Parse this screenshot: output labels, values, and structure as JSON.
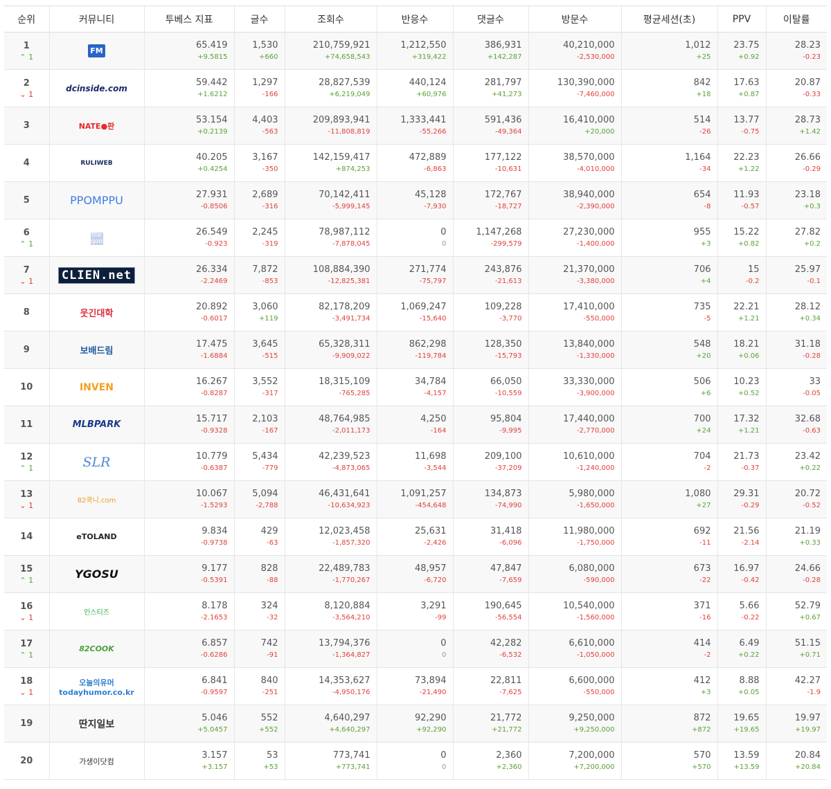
{
  "headers": [
    "순위",
    "커뮤니티",
    "투베스 지표",
    "글수",
    "조회수",
    "반응수",
    "댓글수",
    "방문수",
    "평균세션(초)",
    "PPV",
    "이탈률"
  ],
  "rows": [
    {
      "rank": "1",
      "change": "1",
      "change_dir": "up",
      "logo": {
        "text": "FM",
        "style": "fm"
      },
      "cells": [
        [
          "65.419",
          "+9.5815"
        ],
        [
          "1,530",
          "+660"
        ],
        [
          "210,759,921",
          "+74,658,543"
        ],
        [
          "1,212,550",
          "+319,422"
        ],
        [
          "386,931",
          "+142,287"
        ],
        [
          "40,210,000",
          "-2,530,000"
        ],
        [
          "1,012",
          "+25"
        ],
        [
          "23.75",
          "+0.92"
        ],
        [
          "28.23",
          "-0.23"
        ]
      ]
    },
    {
      "rank": "2",
      "change": "1",
      "change_dir": "down",
      "logo": {
        "text": "dcinside.com",
        "style": "dc"
      },
      "cells": [
        [
          "59.442",
          "+1.6212"
        ],
        [
          "1,297",
          "-166"
        ],
        [
          "28,827,539",
          "+6,219,049"
        ],
        [
          "440,124",
          "+60,976"
        ],
        [
          "281,797",
          "+41,273"
        ],
        [
          "130,390,000",
          "-7,460,000"
        ],
        [
          "842",
          "+18"
        ],
        [
          "17.63",
          "+0.87"
        ],
        [
          "20.87",
          "-0.33"
        ]
      ]
    },
    {
      "rank": "3",
      "change": "",
      "change_dir": "",
      "logo": {
        "text": "NATE●판",
        "style": "nate"
      },
      "cells": [
        [
          "53.154",
          "+0.2139"
        ],
        [
          "4,403",
          "-563"
        ],
        [
          "209,893,941",
          "-11,808,819"
        ],
        [
          "1,333,441",
          "-55,266"
        ],
        [
          "591,436",
          "-49,364"
        ],
        [
          "16,410,000",
          "+20,000"
        ],
        [
          "514",
          "-26"
        ],
        [
          "13.77",
          "-0.75"
        ],
        [
          "28.73",
          "+1.42"
        ]
      ]
    },
    {
      "rank": "4",
      "change": "",
      "change_dir": "",
      "logo": {
        "text": "RULIWEB",
        "style": "ruli"
      },
      "cells": [
        [
          "40.205",
          "+0.4254"
        ],
        [
          "3,167",
          "-350"
        ],
        [
          "142,159,417",
          "+874,253"
        ],
        [
          "472,889",
          "-6,863"
        ],
        [
          "177,122",
          "-10,631"
        ],
        [
          "38,570,000",
          "-4,010,000"
        ],
        [
          "1,164",
          "-34"
        ],
        [
          "22.23",
          "+1.22"
        ],
        [
          "26.66",
          "-0.29"
        ]
      ]
    },
    {
      "rank": "5",
      "change": "",
      "change_dir": "",
      "logo": {
        "text": "PPOMPPU",
        "style": "ppomppu"
      },
      "cells": [
        [
          "27.931",
          "-0.8506"
        ],
        [
          "2,689",
          "-316"
        ],
        [
          "70,142,411",
          "-5,999,145"
        ],
        [
          "45,128",
          "-7,930"
        ],
        [
          "172,767",
          "-18,727"
        ],
        [
          "38,940,000",
          "-2,390,000"
        ],
        [
          "654",
          "-8"
        ],
        [
          "11.93",
          "-0.57"
        ],
        [
          "23.18",
          "+0.3"
        ]
      ]
    },
    {
      "rank": "6",
      "change": "1",
      "change_dir": "up",
      "logo": {
        "text": "the qoo",
        "style": "qoo"
      },
      "cells": [
        [
          "26.549",
          "-0.923"
        ],
        [
          "2,245",
          "-319"
        ],
        [
          "78,987,112",
          "-7,878,045"
        ],
        [
          "0",
          "0"
        ],
        [
          "1,147,268",
          "-299,579"
        ],
        [
          "27,230,000",
          "-1,400,000"
        ],
        [
          "955",
          "+3"
        ],
        [
          "15.22",
          "+0.82"
        ],
        [
          "27.82",
          "+0.2"
        ]
      ]
    },
    {
      "rank": "7",
      "change": "1",
      "change_dir": "down",
      "logo": {
        "text": "CLIEN.net",
        "style": "clien"
      },
      "cells": [
        [
          "26.334",
          "-2.2469"
        ],
        [
          "7,872",
          "-853"
        ],
        [
          "108,884,390",
          "-12,825,381"
        ],
        [
          "271,774",
          "-75,797"
        ],
        [
          "243,876",
          "-21,613"
        ],
        [
          "21,370,000",
          "-3,380,000"
        ],
        [
          "706",
          "+4"
        ],
        [
          "15",
          "-0.2"
        ],
        [
          "25.97",
          "-0.1"
        ]
      ]
    },
    {
      "rank": "8",
      "change": "",
      "change_dir": "",
      "logo": {
        "text": "웃긴대학",
        "style": "humor"
      },
      "cells": [
        [
          "20.892",
          "-0.6017"
        ],
        [
          "3,060",
          "+119"
        ],
        [
          "82,178,209",
          "-3,491,734"
        ],
        [
          "1,069,247",
          "-15,640"
        ],
        [
          "109,228",
          "-3,770"
        ],
        [
          "17,410,000",
          "-550,000"
        ],
        [
          "735",
          "-5"
        ],
        [
          "22.21",
          "+1.21"
        ],
        [
          "28.12",
          "+0.34"
        ]
      ]
    },
    {
      "rank": "9",
      "change": "",
      "change_dir": "",
      "logo": {
        "text": "보배드림",
        "style": "bobae"
      },
      "cells": [
        [
          "17.475",
          "-1.6884"
        ],
        [
          "3,645",
          "-515"
        ],
        [
          "65,328,311",
          "-9,909,022"
        ],
        [
          "862,298",
          "-119,784"
        ],
        [
          "128,350",
          "-15,793"
        ],
        [
          "13,840,000",
          "-1,330,000"
        ],
        [
          "548",
          "+20"
        ],
        [
          "18.21",
          "+0.06"
        ],
        [
          "31.18",
          "-0.28"
        ]
      ]
    },
    {
      "rank": "10",
      "change": "",
      "change_dir": "",
      "logo": {
        "text": "INVEN",
        "style": "inven"
      },
      "cells": [
        [
          "16.267",
          "-0.8287"
        ],
        [
          "3,552",
          "-317"
        ],
        [
          "18,315,109",
          "-765,285"
        ],
        [
          "34,784",
          "-4,157"
        ],
        [
          "66,050",
          "-10,559"
        ],
        [
          "33,330,000",
          "-3,900,000"
        ],
        [
          "506",
          "+6"
        ],
        [
          "10.23",
          "+0.52"
        ],
        [
          "33",
          "-0.05"
        ]
      ]
    },
    {
      "rank": "11",
      "change": "",
      "change_dir": "",
      "logo": {
        "text": "MLBPARK",
        "style": "mlb"
      },
      "cells": [
        [
          "15.717",
          "-0.9328"
        ],
        [
          "2,103",
          "-167"
        ],
        [
          "48,764,985",
          "-2,011,173"
        ],
        [
          "4,250",
          "-164"
        ],
        [
          "95,804",
          "-9,995"
        ],
        [
          "17,440,000",
          "-2,770,000"
        ],
        [
          "700",
          "+24"
        ],
        [
          "17.32",
          "+1.21"
        ],
        [
          "32.68",
          "-0.63"
        ]
      ]
    },
    {
      "rank": "12",
      "change": "1",
      "change_dir": "up",
      "logo": {
        "text": "SLR",
        "style": "slr"
      },
      "cells": [
        [
          "10.779",
          "-0.6387"
        ],
        [
          "5,434",
          "-779"
        ],
        [
          "42,239,523",
          "-4,873,065"
        ],
        [
          "11,698",
          "-3,544"
        ],
        [
          "209,100",
          "-37,209"
        ],
        [
          "10,610,000",
          "-1,240,000"
        ],
        [
          "704",
          "-2"
        ],
        [
          "21.73",
          "-0.37"
        ],
        [
          "23.42",
          "+0.22"
        ]
      ]
    },
    {
      "rank": "13",
      "change": "1",
      "change_dir": "down",
      "logo": {
        "text": "82쿡니.com",
        "style": "ddanzi2"
      },
      "cells": [
        [
          "10.067",
          "-1.5293"
        ],
        [
          "5,094",
          "-2,788"
        ],
        [
          "46,431,641",
          "-10,634,923"
        ],
        [
          "1,091,257",
          "-454,648"
        ],
        [
          "134,873",
          "-74,990"
        ],
        [
          "5,980,000",
          "-1,650,000"
        ],
        [
          "1,080",
          "+27"
        ],
        [
          "29.31",
          "-0.29"
        ],
        [
          "20.72",
          "-0.52"
        ]
      ]
    },
    {
      "rank": "14",
      "change": "",
      "change_dir": "",
      "logo": {
        "text": "eTOLAND",
        "style": "etoland"
      },
      "cells": [
        [
          "9.834",
          "-0.9738"
        ],
        [
          "429",
          "-63"
        ],
        [
          "12,023,458",
          "-1,857,320"
        ],
        [
          "25,631",
          "-2,426"
        ],
        [
          "31,418",
          "-6,096"
        ],
        [
          "11,980,000",
          "-1,750,000"
        ],
        [
          "692",
          "-11"
        ],
        [
          "21.56",
          "-2.14"
        ],
        [
          "21.19",
          "+0.33"
        ]
      ]
    },
    {
      "rank": "15",
      "change": "1",
      "change_dir": "up",
      "logo": {
        "text": "YGOSU",
        "style": "ygosu"
      },
      "cells": [
        [
          "9.177",
          "-0.5391"
        ],
        [
          "828",
          "-88"
        ],
        [
          "22,489,783",
          "-1,770,267"
        ],
        [
          "48,957",
          "-6,720"
        ],
        [
          "47,847",
          "-7,659"
        ],
        [
          "6,080,000",
          "-590,000"
        ],
        [
          "673",
          "-22"
        ],
        [
          "16.97",
          "-0.42"
        ],
        [
          "24.66",
          "-0.28"
        ]
      ]
    },
    {
      "rank": "16",
      "change": "1",
      "change_dir": "down",
      "logo": {
        "text": "인스티즈",
        "style": "instiz"
      },
      "cells": [
        [
          "8.178",
          "-2.1653"
        ],
        [
          "324",
          "-32"
        ],
        [
          "8,120,884",
          "-3,564,210"
        ],
        [
          "3,291",
          "-99"
        ],
        [
          "190,645",
          "-56,554"
        ],
        [
          "10,540,000",
          "-1,560,000"
        ],
        [
          "371",
          "-16"
        ],
        [
          "5.66",
          "-0.22"
        ],
        [
          "52.79",
          "+0.67"
        ]
      ]
    },
    {
      "rank": "17",
      "change": "1",
      "change_dir": "up",
      "logo": {
        "text": "82COOK",
        "style": "cook"
      },
      "cells": [
        [
          "6.857",
          "-0.6286"
        ],
        [
          "742",
          "-91"
        ],
        [
          "13,794,376",
          "-1,364,827"
        ],
        [
          "0",
          "0"
        ],
        [
          "42,282",
          "-6,532"
        ],
        [
          "6,610,000",
          "-1,050,000"
        ],
        [
          "414",
          "-2"
        ],
        [
          "6.49",
          "+0.22"
        ],
        [
          "51.15",
          "+0.71"
        ]
      ]
    },
    {
      "rank": "18",
      "change": "1",
      "change_dir": "down",
      "logo": {
        "text": "오늘의유머 todayhumor.co.kr",
        "style": "today"
      },
      "cells": [
        [
          "6.841",
          "-0.9597"
        ],
        [
          "840",
          "-251"
        ],
        [
          "14,353,627",
          "-4,950,176"
        ],
        [
          "73,894",
          "-21,490"
        ],
        [
          "22,811",
          "-7,625"
        ],
        [
          "6,600,000",
          "-550,000"
        ],
        [
          "412",
          "+3"
        ],
        [
          "8.88",
          "+0.05"
        ],
        [
          "42.27",
          "-1.9"
        ]
      ]
    },
    {
      "rank": "19",
      "change": "",
      "change_dir": "",
      "logo": {
        "text": "딴지일보",
        "style": "ddanzi"
      },
      "cells": [
        [
          "5.046",
          "+5.0457"
        ],
        [
          "552",
          "+552"
        ],
        [
          "4,640,297",
          "+4,640,297"
        ],
        [
          "92,290",
          "+92,290"
        ],
        [
          "21,772",
          "+21,772"
        ],
        [
          "9,250,000",
          "+9,250,000"
        ],
        [
          "872",
          "+872"
        ],
        [
          "19.65",
          "+19.65"
        ],
        [
          "19.97",
          "+19.97"
        ]
      ]
    },
    {
      "rank": "20",
      "change": "",
      "change_dir": "",
      "logo": {
        "text": "가생이닷컴",
        "style": "gasengi"
      },
      "cells": [
        [
          "3.157",
          "+3.157"
        ],
        [
          "53",
          "+53"
        ],
        [
          "773,741",
          "+773,741"
        ],
        [
          "0",
          "0"
        ],
        [
          "2,360",
          "+2,360"
        ],
        [
          "7,200,000",
          "+7,200,000"
        ],
        [
          "570",
          "+570"
        ],
        [
          "13.59",
          "+13.59"
        ],
        [
          "20.84",
          "+20.84"
        ]
      ]
    }
  ]
}
